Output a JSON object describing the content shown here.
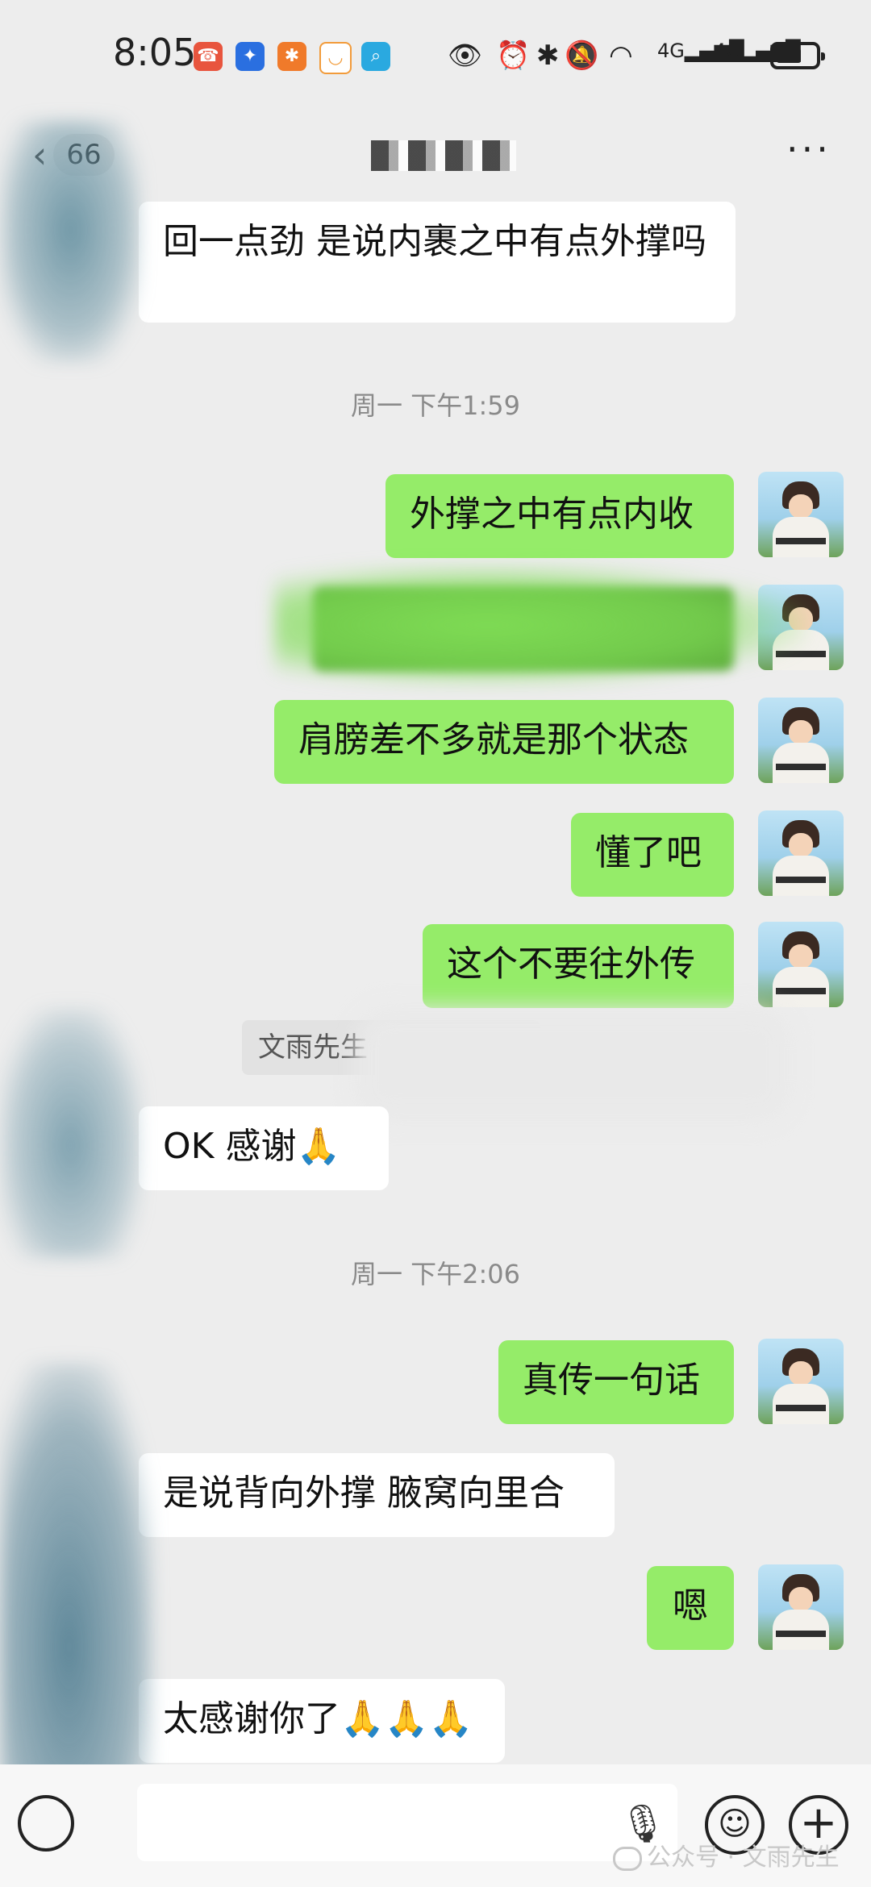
{
  "status_bar": {
    "time": "8:05",
    "network_1": "4G",
    "network_2": "4G"
  },
  "header": {
    "back_count": "66",
    "title": "",
    "more_label": "···"
  },
  "messages": {
    "m1": "回一点劲  是说内裹之中有点外撑吗",
    "ts1": "周一 下午1:59",
    "m2": "外撑之中有点内收",
    "m3": "肩膀差不多就是那个状态",
    "m4": "懂了吧",
    "m5": "这个不要往外传",
    "quote": "文雨先生",
    "m6": "OK   感谢🙏",
    "ts2": "周一 下午2:06",
    "m7": "真传一句话",
    "m8": "是说背向外撑  腋窝向里合",
    "m9": "嗯",
    "m10": "太感谢你了🙏🙏🙏"
  },
  "watermark": "公众号 · 文雨先生",
  "colors": {
    "outgoing_bubble": "#95ec69",
    "incoming_bubble": "#ffffff",
    "background": "#ededed"
  }
}
